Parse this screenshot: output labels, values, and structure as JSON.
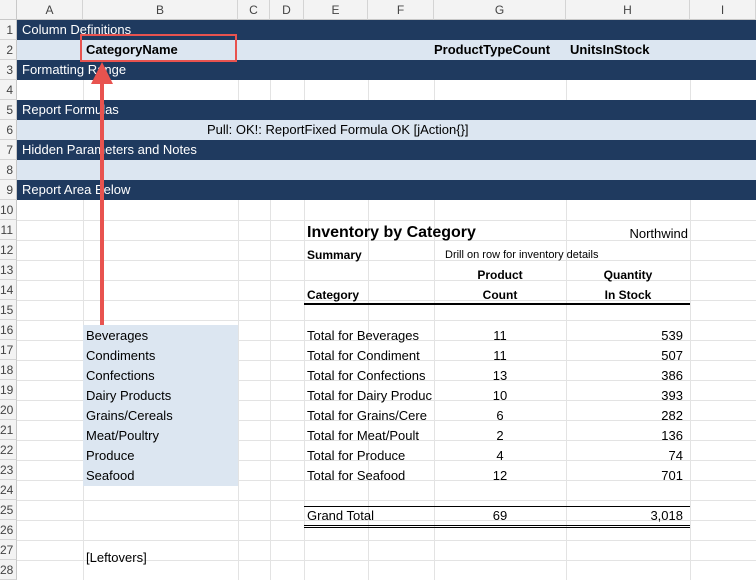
{
  "columns": [
    "A",
    "B",
    "C",
    "D",
    "E",
    "F",
    "G",
    "H",
    "I"
  ],
  "rows": [
    "1",
    "2",
    "3",
    "4",
    "5",
    "6",
    "7",
    "8",
    "9",
    "10",
    "11",
    "12",
    "13",
    "14",
    "15",
    "16",
    "17",
    "18",
    "19",
    "20",
    "21",
    "22",
    "23",
    "24",
    "25",
    "26",
    "27",
    "28"
  ],
  "bands": {
    "column_definitions": "Column Definitions",
    "formatting_range": "Formatting Range",
    "report_formulas": "Report Formulas",
    "hidden_parameters": "Hidden Parameters and Notes",
    "report_area_below": "Report Area Below"
  },
  "row2": {
    "category_name": "CategoryName",
    "product_type_count": "ProductTypeCount",
    "units_in_stock": "UnitsInStock"
  },
  "row6": {
    "formula_status": "Pull:  OK!: ReportFixed Formula OK [jAction{}]"
  },
  "report": {
    "title": "Inventory by Category",
    "source": "Northwind",
    "summary": "Summary",
    "drill_note": "Drill on row for inventory details",
    "col_category": "Category",
    "col_product_1": "Product",
    "col_product_2": "Count",
    "col_qty_1": "Quantity",
    "col_qty_2": "In Stock",
    "rows": [
      {
        "label": "Total for Beverages",
        "count": "11",
        "stock": "539"
      },
      {
        "label": "Total for Condiment",
        "count": "11",
        "stock": "507"
      },
      {
        "label": "Total for Confections",
        "count": "13",
        "stock": "386"
      },
      {
        "label": "Total for Dairy Produc",
        "count": "10",
        "stock": "393"
      },
      {
        "label": "Total for Grains/Cere",
        "count": "6",
        "stock": "282"
      },
      {
        "label": "Total for Meat/Poult",
        "count": "2",
        "stock": "136"
      },
      {
        "label": "Total for Produce",
        "count": "4",
        "stock": "74"
      },
      {
        "label": "Total for Seafood",
        "count": "12",
        "stock": "701"
      }
    ],
    "grand_total_label": "Grand Total",
    "grand_total_count": "69",
    "grand_total_stock": "3,018"
  },
  "categories": [
    "Beverages",
    "Condiments",
    "Confections",
    "Dairy Products",
    "Grains/Cereals",
    "Meat/Poultry",
    "Produce",
    "Seafood"
  ],
  "leftovers": "[Leftovers]",
  "colors": {
    "band_dark": "#1f3a5f",
    "band_light": "#dce6f1",
    "annotation": "#e8534f"
  }
}
